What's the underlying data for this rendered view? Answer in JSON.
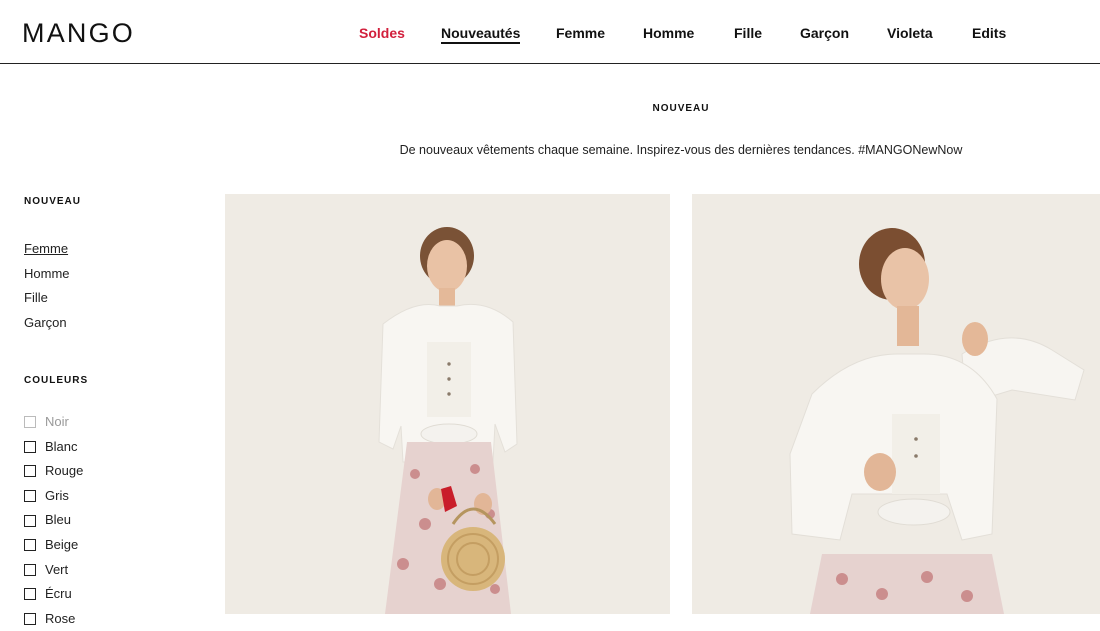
{
  "brand": {
    "logo": "MANGO"
  },
  "nav": {
    "items": [
      {
        "label": "Soldes"
      },
      {
        "label": "Nouveautés"
      },
      {
        "label": "Femme"
      },
      {
        "label": "Homme"
      },
      {
        "label": "Fille"
      },
      {
        "label": "Garçon"
      },
      {
        "label": "Violeta"
      },
      {
        "label": "Edits"
      }
    ],
    "active": "Nouveautés",
    "sale_color": "#d21f3c"
  },
  "intro": {
    "title": "NOUVEAU",
    "text": "De nouveaux vêtements chaque semaine. Inspirez-vous des dernières tendances. #MANGONewNow"
  },
  "sidebar": {
    "section_new": {
      "heading": "NOUVEAU",
      "links": [
        {
          "label": "Femme",
          "selected": true
        },
        {
          "label": "Homme"
        },
        {
          "label": "Fille"
        },
        {
          "label": "Garçon"
        }
      ]
    },
    "section_colors": {
      "heading": "COULEURS",
      "options": [
        {
          "label": "Noir",
          "disabled": true
        },
        {
          "label": "Blanc"
        },
        {
          "label": "Rouge"
        },
        {
          "label": "Gris"
        },
        {
          "label": "Bleu"
        },
        {
          "label": "Beige"
        },
        {
          "label": "Vert"
        },
        {
          "label": "Écru"
        },
        {
          "label": "Rose"
        }
      ]
    }
  },
  "products": [
    {
      "image": "model-white-shirt-paisley-trousers-basket-bag"
    },
    {
      "image": "model-white-shirt-paisley-trousers-portrait"
    }
  ],
  "colors": {
    "photo_background": "#efebe4",
    "text": "#111111"
  }
}
